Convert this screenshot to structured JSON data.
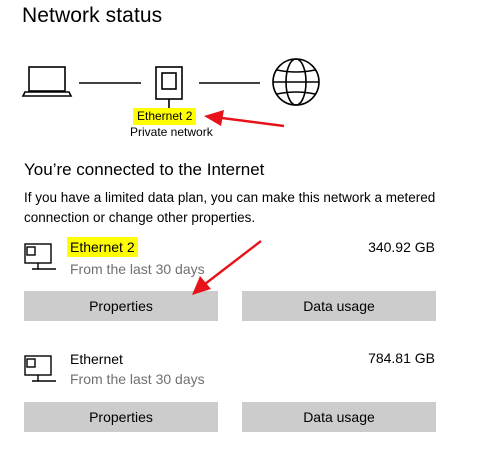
{
  "header": {
    "title": "Network status"
  },
  "diagram": {
    "adapter_label": "Ethernet 2",
    "network_type": "Private network"
  },
  "status": {
    "heading": "You’re connected to the Internet",
    "description": "If you have a limited data plan, you can make this network a metered connection or change other properties."
  },
  "connections": [
    {
      "name": "Ethernet 2",
      "period": "From the last 30 days",
      "usage": "340.92 GB",
      "properties_label": "Properties",
      "data_usage_label": "Data usage"
    },
    {
      "name": "Ethernet",
      "period": "From the last 30 days",
      "usage": "784.81 GB",
      "properties_label": "Properties",
      "data_usage_label": "Data usage"
    }
  ],
  "annotation_colors": {
    "highlight": "#ffff00",
    "arrow": "#e8121b"
  },
  "icons": [
    "laptop-icon",
    "ethernet-port-icon",
    "globe-icon",
    "ethernet-adapter-icon"
  ]
}
